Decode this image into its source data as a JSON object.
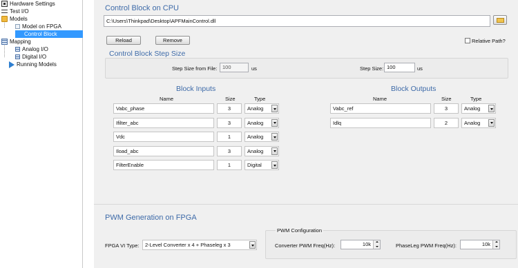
{
  "tree": {
    "items": [
      {
        "label": "Hardware Settings",
        "icon": "hardware-settings-icon"
      },
      {
        "label": "Test I/O",
        "icon": "test-io-icon"
      },
      {
        "label": "Models",
        "icon": "folder-icon"
      },
      {
        "label": "Model on FPGA",
        "icon": "fpga-model-icon"
      },
      {
        "label": "Control Block",
        "icon": "control-block-icon",
        "selected": true
      },
      {
        "label": "Mapping",
        "icon": "mapping-icon"
      },
      {
        "label": "Analog I/O",
        "icon": "analog-io-icon"
      },
      {
        "label": "Digital I/O",
        "icon": "digital-io-icon"
      },
      {
        "label": "Running Models",
        "icon": "play-icon"
      }
    ]
  },
  "control_block": {
    "title": "Control Block on CPU",
    "path": "C:\\Users\\Thinkpad\\Desktop\\APFMainControl.dll",
    "reload_label": "Reload",
    "remove_label": "Remove",
    "relative_path_label": "Relative Path?",
    "relative_path_checked": false
  },
  "step_size": {
    "title": "Control Block Step Size",
    "from_file_label": "Step Size from File:",
    "from_file_value": "100",
    "from_file_unit": "us",
    "step_label": "Step Size:",
    "step_value": "100",
    "step_unit": "us"
  },
  "block_inputs": {
    "title": "Block Inputs",
    "headers": {
      "name": "Name",
      "size": "Size",
      "type": "Type"
    },
    "rows": [
      {
        "name": "Vabc_phase",
        "size": "3",
        "type": "Analog"
      },
      {
        "name": "Ifilter_abc",
        "size": "3",
        "type": "Analog"
      },
      {
        "name": "Vdc",
        "size": "1",
        "type": "Analog"
      },
      {
        "name": "Iload_abc",
        "size": "3",
        "type": "Analog"
      },
      {
        "name": "FilterEnable",
        "size": "1",
        "type": "Digital"
      }
    ]
  },
  "block_outputs": {
    "title": "Block Outputs",
    "headers": {
      "name": "Name",
      "size": "Size",
      "type": "Type"
    },
    "rows": [
      {
        "name": "Vabc_ref",
        "size": "3",
        "type": "Analog"
      },
      {
        "name": "Idlq",
        "size": "2",
        "type": "Analog"
      }
    ]
  },
  "pwm": {
    "title": "PWM Generation on FPGA",
    "vi_type_label": "FPGA VI Type:",
    "vi_type_value": "2-Level Converter x 4 + Phaseleg x 3",
    "config_title": "PWM Configuration",
    "converter_label": "Converter PWM Freq(Hz):",
    "converter_value": "10k",
    "phaseleg_label": "PhaseLeg PWM Freq(Hz):",
    "phaseleg_value": "10k"
  }
}
